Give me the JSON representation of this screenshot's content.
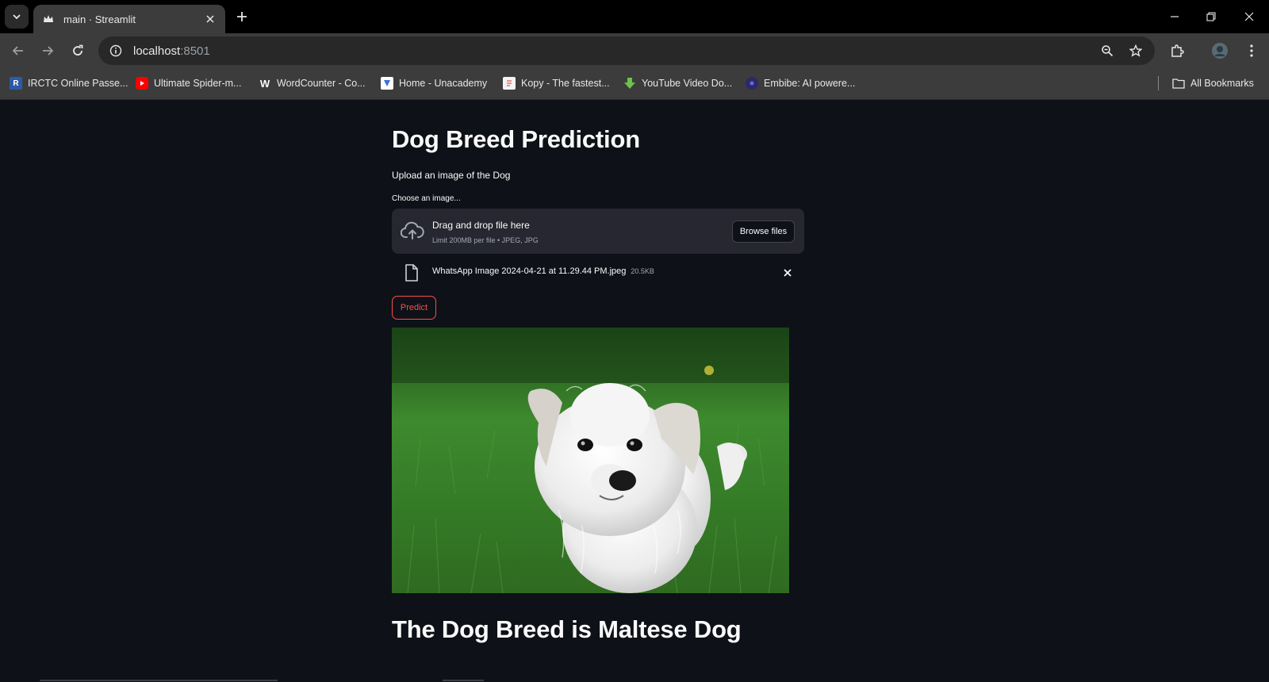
{
  "browser": {
    "tab_title": "main · Streamlit",
    "url_host": "localhost",
    "url_port": ":8501",
    "bookmarks": [
      {
        "label": "IRCTC Online Passe...",
        "icon": "irctc-icon",
        "color": "#2d5aa8"
      },
      {
        "label": "Ultimate Spider-m...",
        "icon": "youtube-icon",
        "color": "#ff0000"
      },
      {
        "label": "WordCounter - Co...",
        "icon": "wordcounter-icon",
        "color": "#3c3c3c"
      },
      {
        "label": "Home - Unacademy",
        "icon": "unacademy-icon",
        "color": "#3c6fd9"
      },
      {
        "label": "Kopy - The fastest...",
        "icon": "document-icon",
        "color": "#e05a4f"
      },
      {
        "label": "YouTube Video Do...",
        "icon": "download-arrow-icon",
        "color": "#6cc24a"
      },
      {
        "label": "Embibe: AI powere...",
        "icon": "embibe-icon",
        "color": "#2a2a6a"
      }
    ],
    "all_bookmarks": "All Bookmarks"
  },
  "app": {
    "title": "Dog Breed Prediction",
    "subtitle": "Upload an image of the Dog",
    "uploader": {
      "label": "Choose an image...",
      "drag_text": "Drag and drop file here",
      "limit_text": "Limit 200MB per file • JPEG, JPG",
      "browse_label": "Browse files"
    },
    "file": {
      "name": "WhatsApp Image 2024-04-21 at 11.29.44 PM.jpeg",
      "size": "20.5KB"
    },
    "predict_label": "Predict",
    "result": "The Dog Breed is Maltese Dog"
  },
  "colors": {
    "background": "#0e1117",
    "widget_bg": "#262730",
    "primary": "#ff4b4b",
    "text": "#fafafa"
  }
}
